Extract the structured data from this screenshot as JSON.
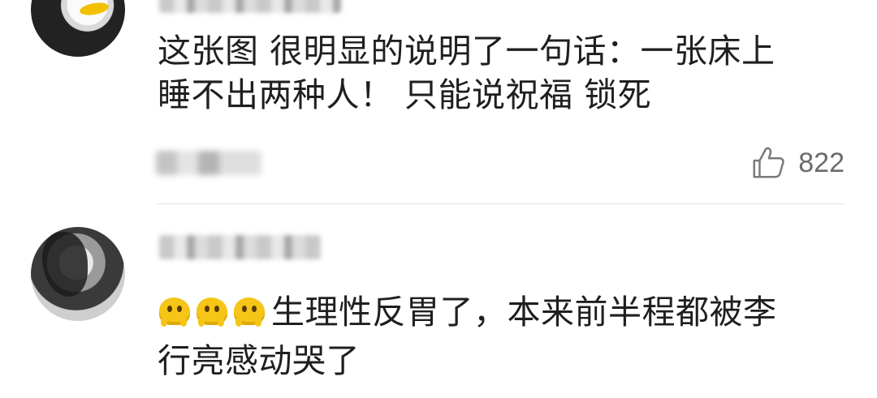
{
  "comments": [
    {
      "text_line1": "这张图 很明显的说明了一句话：一张床上",
      "text_line2": "睡不出两种人！ 只能说祝福 锁死",
      "likes": "822"
    },
    {
      "emojis": [
        "yellow-melting-face-icon",
        "yellow-melting-face-icon",
        "yellow-melting-face-icon"
      ],
      "text_line1": "生理性反胃了，本来前半程都被李",
      "text_line2": "行亮感动哭了"
    }
  ]
}
